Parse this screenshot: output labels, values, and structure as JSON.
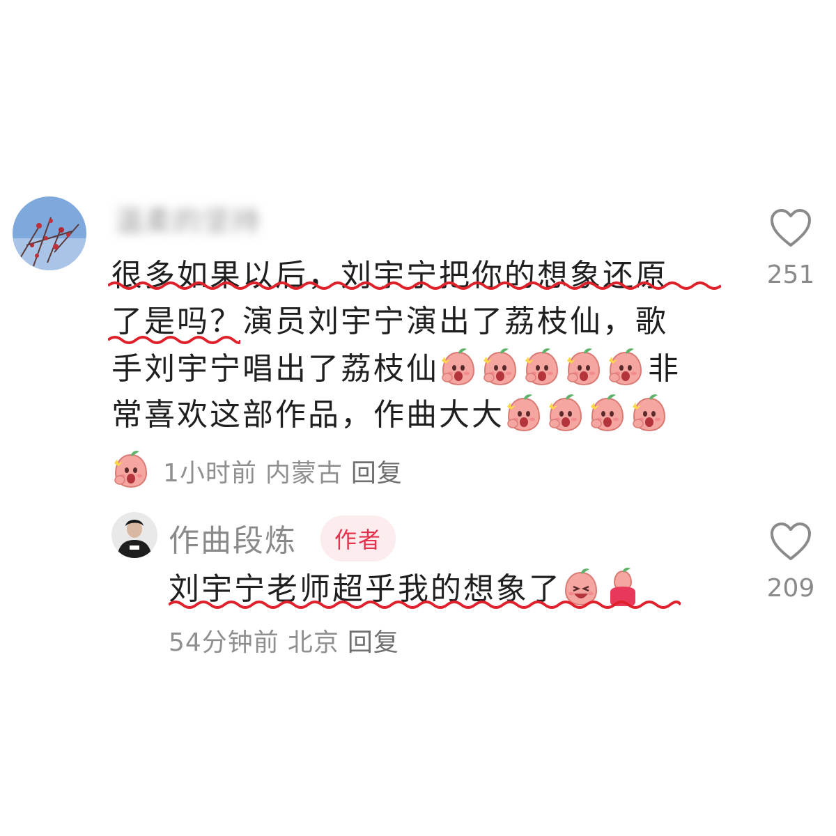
{
  "comments": [
    {
      "username": "温柔的坚持",
      "body_lines": [
        "很多如果以后，刘宇宁把你的想象还原",
        "了是吗？演员刘宇宁演出了荔枝仙，歌",
        "手刘宇宁唱出了荔枝仙",
        "常喜欢这部作品，作曲大大"
      ],
      "line3_tail": "非",
      "time": "1小时前",
      "location": "内蒙古",
      "reply_label": "回复",
      "likes": "251"
    },
    {
      "username": "作曲段炼",
      "badge": "作者",
      "body": "刘宇宁老师超乎我的想象了",
      "time": "54分钟前",
      "location": "北京",
      "reply_label": "回复",
      "likes": "209"
    }
  ],
  "colors": {
    "underline": "#e0202a",
    "badge_bg": "#fdecee",
    "badge_text": "#e4314c",
    "meta_text": "#8f8f8f"
  },
  "icons": {
    "like": "heart-outline-icon",
    "emoji": "peach-surprised-emoji"
  }
}
